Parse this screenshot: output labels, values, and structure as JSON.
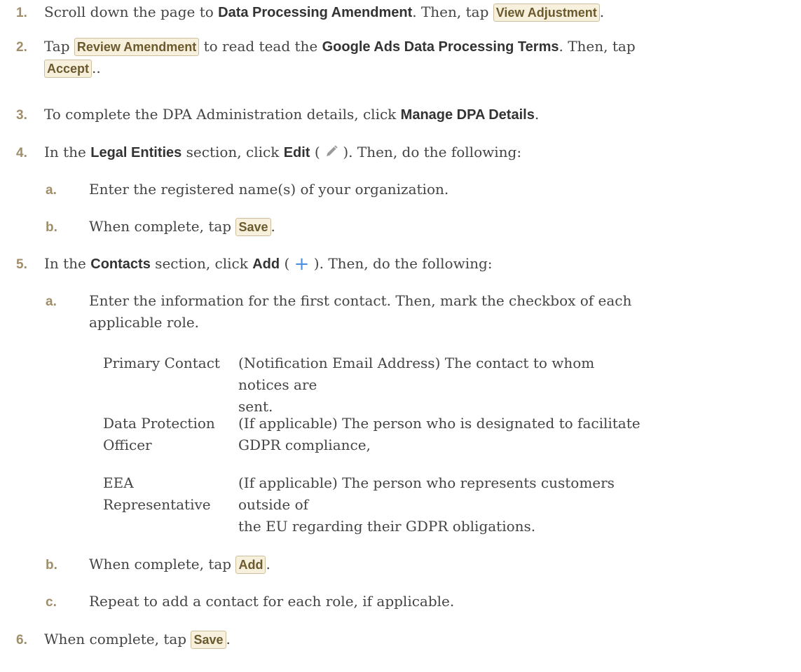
{
  "steps": [
    {
      "num": "1.",
      "t1": "Scroll down the page to ",
      "b1": "Data Processing Amendment",
      "t2": ". Then, tap ",
      "btn": "View Adjustment",
      "t3": "."
    },
    {
      "num": "2.",
      "t1": "Tap ",
      "btn1": "Review Amendment",
      "t2": " to read tead the ",
      "b1": "Google Ads Data Processing Terms",
      "t3": ".  Then, tap",
      "btn2": "Accept",
      "t4": ".."
    },
    {
      "num": "3.",
      "t1": "To complete the DPA Administration details, click ",
      "b1": "Manage DPA Details",
      "t2": "."
    },
    {
      "num": "4.",
      "t1": "In the ",
      "b1": "Legal Entities",
      "t2": " section, click ",
      "b2": "Edit",
      "t3": " ( ",
      "icon": "pencil-icon",
      "t4": " ).  Then, do the following:",
      "sub": [
        {
          "num": "a.",
          "t1": "Enter the registered name(s) of your organization."
        },
        {
          "num": "b.",
          "t1": "When complete, tap ",
          "btn": "Save",
          "t2": "."
        }
      ]
    },
    {
      "num": "5.",
      "t1": "In the ",
      "b1": "Contacts",
      "t2": " section, click ",
      "b2": "Add",
      "t3": " ( ",
      "icon": "plus-icon",
      "icon_glyph": "+",
      "t4": " ). Then, do the following:",
      "sub": [
        {
          "num": "a.",
          "line1": "Enter the information for the first contact. Then, mark the checkbox of each",
          "line2": "applicable role."
        },
        {
          "num": "b.",
          "t1": "When complete, tap ",
          "btn": "Add",
          "t2": "."
        },
        {
          "num": "c.",
          "t1": "Repeat to add a contact for each role, if applicable."
        }
      ]
    },
    {
      "num": "6.",
      "t1": "When complete, tap ",
      "btn": "Save",
      "t2": "."
    }
  ],
  "roles": [
    {
      "label_l1": "Primary Contact",
      "label_l2": "",
      "desc_l1": "(Notification Email Address) The contact to whom notices are",
      "desc_l2": "sent."
    },
    {
      "label_l1": "Data Protection",
      "label_l2": "Officer",
      "desc_l1": "(If applicable) The person who is designated to facilitate",
      "desc_l2": "GDPR compliance,"
    },
    {
      "label_l1": "EEA",
      "label_l2": "Representative",
      "desc_l1": "(If applicable) The person who represents customers outside of",
      "desc_l2": "the EU regarding their GDPR obligations."
    }
  ],
  "colors": {
    "accent_number": "#a08e6a",
    "button_bg": "#f7f0dd",
    "button_border": "#cdbf9d",
    "icon_blue": "#4a90e2"
  }
}
